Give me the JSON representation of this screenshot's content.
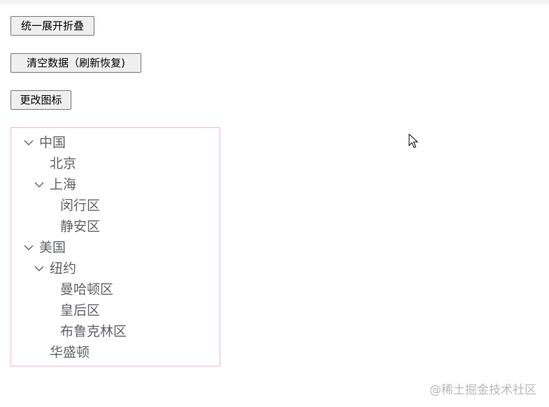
{
  "buttons": {
    "toggle_label": "统一展开折叠",
    "clear_label": "清空数据（刷新恢复)",
    "icon_label": "更改图标"
  },
  "tree": [
    {
      "label": "中国",
      "level": 1,
      "expanded": true
    },
    {
      "label": "北京",
      "level": 2,
      "leaf": true
    },
    {
      "label": "上海",
      "level": 2,
      "expanded": true
    },
    {
      "label": "闵行区",
      "level": 3,
      "leaf": true
    },
    {
      "label": "静安区",
      "level": 3,
      "leaf": true
    },
    {
      "label": "美国",
      "level": 1,
      "expanded": true
    },
    {
      "label": "纽约",
      "level": 2,
      "expanded": true
    },
    {
      "label": "曼哈顿区",
      "level": 3,
      "leaf": true
    },
    {
      "label": "皇后区",
      "level": 3,
      "leaf": true
    },
    {
      "label": "布鲁克林区",
      "level": 3,
      "leaf": true
    },
    {
      "label": "华盛顿",
      "level": 2,
      "leaf": true
    }
  ],
  "watermark": "@稀土掘金技术社区",
  "colors": {
    "tree_border": "#f0b8c9",
    "tree_text": "#606266",
    "arrow": "#606266"
  },
  "icons": {
    "expanded": "chevron-down-icon",
    "cursor": "mouse-pointer-icon"
  }
}
